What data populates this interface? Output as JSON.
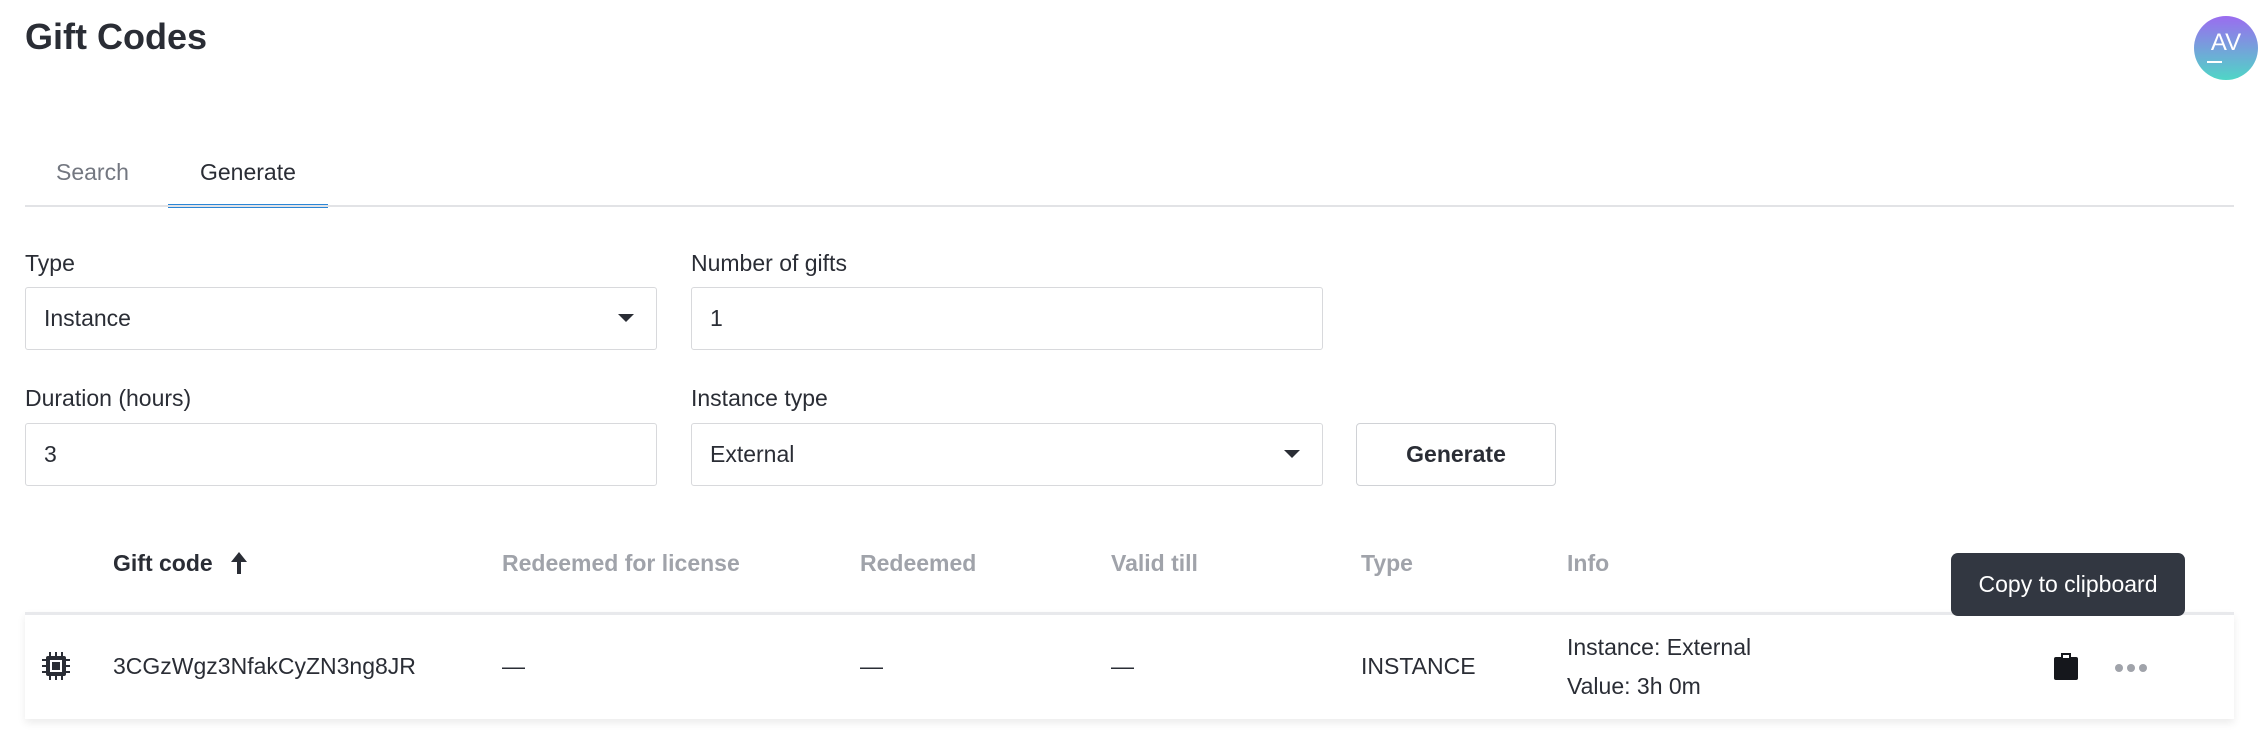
{
  "header": {
    "title": "Gift Codes",
    "avatar_initials": "AV"
  },
  "tabs": [
    {
      "label": "Search",
      "active": false
    },
    {
      "label": "Generate",
      "active": true
    }
  ],
  "form": {
    "type": {
      "label": "Type",
      "value": "Instance"
    },
    "number_of_gifts": {
      "label": "Number of gifts",
      "value": "1"
    },
    "duration": {
      "label": "Duration (hours)",
      "value": "3"
    },
    "instance_type": {
      "label": "Instance type",
      "value": "External"
    },
    "generate_label": "Generate"
  },
  "table": {
    "columns": [
      "Gift code",
      "Redeemed for license",
      "Redeemed",
      "Valid till",
      "Type",
      "Info"
    ],
    "sort_icon": "arrow-up-icon",
    "rows": [
      {
        "code": "3CGzWgz3NfakCyZN3ng8JR",
        "redeemed_for_license": "—",
        "redeemed": "—",
        "valid_till": "—",
        "type": "INSTANCE",
        "info_line1": "Instance: External",
        "info_line2": "Value: 3h 0m"
      }
    ]
  },
  "tooltip": "Copy to clipboard",
  "colors": {
    "accent": "#2b86d6",
    "tooltip_bg": "#323741"
  }
}
